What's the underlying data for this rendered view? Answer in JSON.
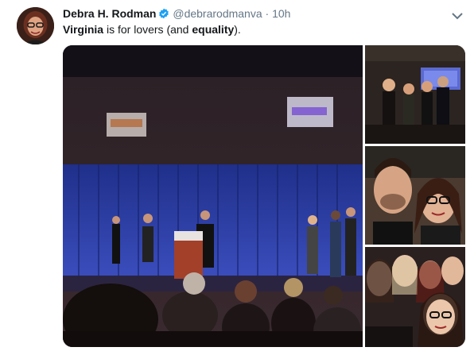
{
  "tweet": {
    "author_name": "Debra H. Rodman",
    "author_handle": "@debrarodmanva",
    "separator": "·",
    "time": "10h",
    "text_parts": [
      "Virginia",
      " is for lovers (and ",
      "equality",
      ")."
    ]
  },
  "icons": {
    "verified": "verified-badge-icon",
    "menu": "chevron-down-icon"
  },
  "colors": {
    "verified_blue": "#1da1f2",
    "muted_text": "#657786",
    "stage_blue": "#2b3f9e"
  },
  "media": {
    "photo_count": 4
  }
}
